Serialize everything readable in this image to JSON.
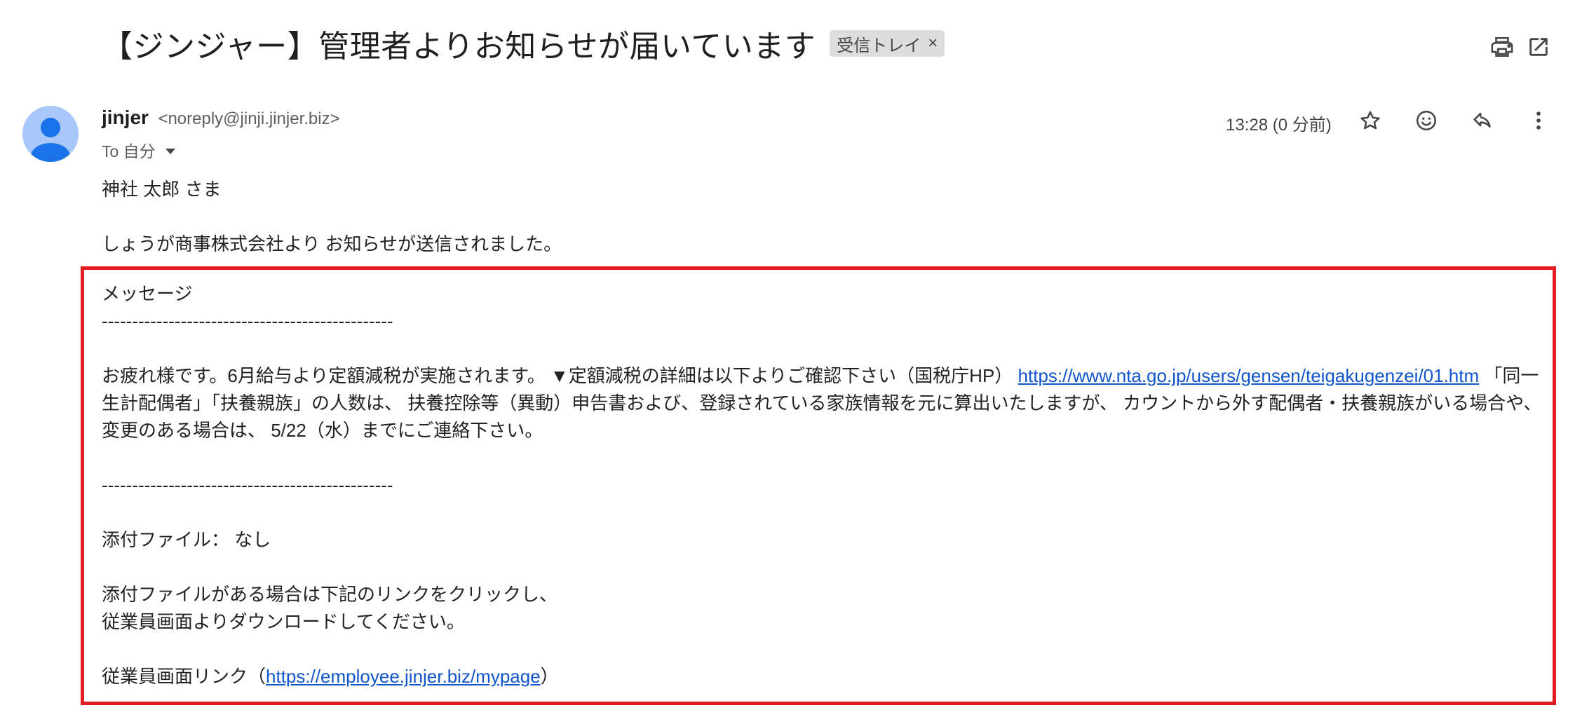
{
  "email": {
    "subject": "【ジンジャー】管理者よりお知らせが届いています",
    "label_chip": "受信トレイ",
    "label_chip_remove": "×",
    "sender_name": "jinjer",
    "sender_email": "<noreply@jinji.jinjer.biz>",
    "to_label": "To 自分",
    "timestamp": "13:28 (0 分前)"
  },
  "icons": {
    "print": "print-icon",
    "open_new_window": "open-in-new-window-icon",
    "star": "star-icon",
    "emoji": "emoji-reaction-icon",
    "reply": "reply-icon",
    "more": "more-vert-icon",
    "avatar": "default-avatar-icon"
  },
  "body": {
    "greeting": "神社 太郎 さま",
    "intro": "しょうが商事株式会社より お知らせが送信されました。",
    "message_heading": "メッセージ",
    "divider": "------------------------------------------------",
    "message_text_1": "お疲れ様です。6月給与より定額減税が実施されます。 ▼定額減税の詳細は以下よりご確認下さい（国税庁HP） ",
    "message_link": "https://www.nta.go.jp/users/gensen/teigakugenzei/01.htm",
    "message_text_2": " 「同一生計配偶者」「扶養親族」の人数は、 扶養控除等（異動）申告書および、登録されている家族情報を元に算出いたしますが、 カウントから外す配偶者・扶養親族がいる場合や、変更のある場合は、 5/22（水）までにご連絡下さい。",
    "attachment_line": "添付ファイル： なし",
    "attachment_note_1": "添付ファイルがある場合は下記のリンクをクリックし、",
    "attachment_note_2": "従業員画面よりダウンロードしてください。",
    "employee_link_prefix": "従業員画面リンク（",
    "employee_link": "https://employee.jinjer.biz/mypage",
    "employee_link_suffix": "）"
  },
  "colors": {
    "highlight_border": "#e51b23",
    "link": "#1155cc",
    "avatar_bg": "#a8c7fa",
    "avatar_fg": "#1a73e8",
    "chip_bg": "#dddddd"
  }
}
